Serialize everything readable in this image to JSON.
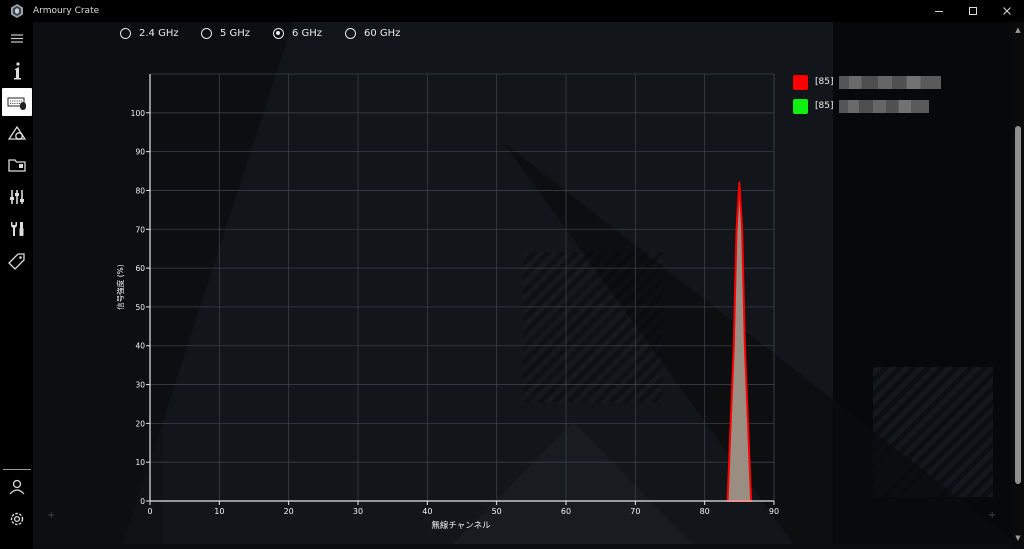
{
  "window": {
    "title": "Armoury Crate"
  },
  "colors": {
    "series_red": "#ff0000",
    "series_green": "#11ee11",
    "accent_white": "#ffffff"
  },
  "sidebar": {
    "items": [
      {
        "name": "menu-icon"
      },
      {
        "name": "info-icon"
      },
      {
        "name": "keyboard-icon",
        "active": true
      },
      {
        "name": "aura-icon"
      },
      {
        "name": "folder-icon"
      },
      {
        "name": "equalizer-icon"
      },
      {
        "name": "tools-icon"
      },
      {
        "name": "tag-icon"
      }
    ],
    "bottom": [
      {
        "name": "user-icon"
      },
      {
        "name": "settings-icon"
      }
    ]
  },
  "bands": {
    "options": [
      {
        "label": "2.4 GHz",
        "selected": false
      },
      {
        "label": "5 GHz",
        "selected": false
      },
      {
        "label": "6 GHz",
        "selected": true
      },
      {
        "label": "60 GHz",
        "selected": false
      }
    ]
  },
  "legend": [
    {
      "label": "[85]",
      "color": "#ff0000"
    },
    {
      "label": "[85]",
      "color": "#11ee11"
    }
  ],
  "chart_data": {
    "type": "area",
    "xlabel": "無線チャンネル",
    "ylabel": "信号強度 (%)",
    "xlim": [
      0,
      90
    ],
    "ylim": [
      0,
      110
    ],
    "x_ticks": [
      0,
      10,
      20,
      30,
      40,
      50,
      60,
      70,
      80,
      90
    ],
    "y_ticks": [
      0,
      10,
      20,
      30,
      40,
      50,
      60,
      70,
      80,
      90,
      100
    ],
    "grid": true,
    "series": [
      {
        "label": "[85]",
        "color": "#ff0000",
        "x": [
          83.3,
          84.2,
          84.6,
          85.0,
          85.4,
          85.8,
          86.7
        ],
        "y": [
          0,
          40,
          70,
          82,
          70,
          40,
          0
        ]
      }
    ]
  }
}
